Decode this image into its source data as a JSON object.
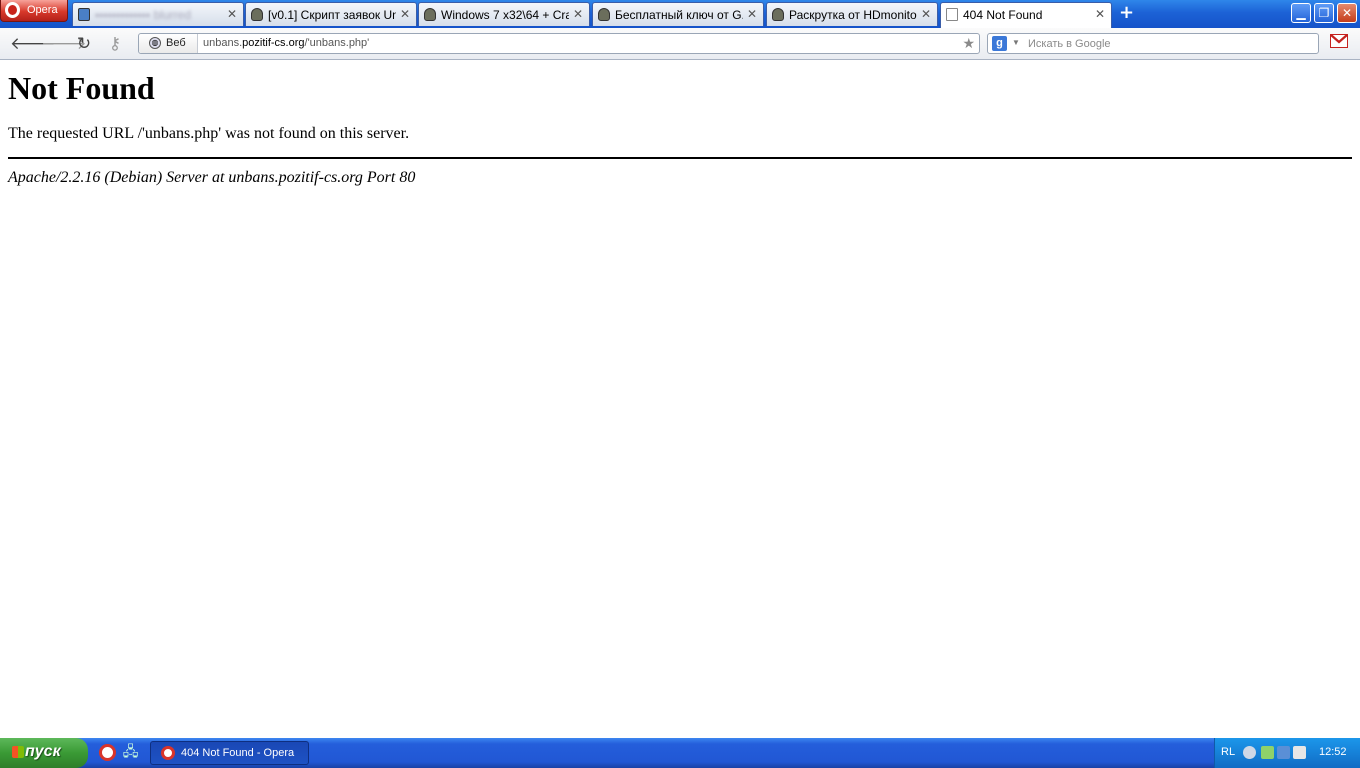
{
  "browser": {
    "menu_label": "Opera",
    "tabs": [
      {
        "label": "▪▪▪▪▪▪▪▪▪▪▪▪▪ blurred",
        "icon": "play-icon",
        "blurred": true
      },
      {
        "label": "[v0.1] Скрипт заявок Un...",
        "icon": "agent-icon"
      },
      {
        "label": "Windows 7 x32\\64 + Cra...",
        "icon": "agent-icon"
      },
      {
        "label": "Бесплатный ключ от G...",
        "icon": "agent-icon"
      },
      {
        "label": "Раскрутка от HDmonito...",
        "icon": "agent-icon"
      },
      {
        "label": "404 Not Found",
        "icon": "page-icon",
        "active": true
      }
    ],
    "close_glyph": "✕",
    "new_tab_glyph": "+",
    "window_controls": {
      "minimize": "▁",
      "maximize": "❐",
      "close": "✕"
    }
  },
  "navbar": {
    "back_glyph": "🡐",
    "forward_glyph": "🡒",
    "reload_glyph": "↻",
    "key_glyph": "⚷",
    "address": {
      "badge": "Веб",
      "url_prefix": "unbans.",
      "url_domain": "pozitif-cs.org",
      "url_path": "/'unbans.php'",
      "bookmark_glyph": "★"
    },
    "search": {
      "engine_glyph": "g",
      "dropdown_glyph": "▼",
      "placeholder": "Искать в Google"
    },
    "gmail_glyph": "M"
  },
  "page": {
    "heading": "Not Found",
    "message": "The requested URL /'unbans.php' was not found on this server.",
    "address": "Apache/2.2.16 (Debian) Server at unbans.pozitif-cs.org Port 80"
  },
  "taskbar": {
    "start_label": "пуск",
    "quick_launch": [
      {
        "name": "opera-icon"
      },
      {
        "name": "network-icon"
      }
    ],
    "net_glyph": "🖧",
    "task": {
      "label": "404 Not Found - Opera"
    },
    "tray": {
      "lang": "RL",
      "clock": "12:52"
    }
  },
  "colors": {
    "title_blue": "#1c62d6",
    "opera_red": "#d8392b",
    "xp_green": "#3a9a35",
    "tray_blue": "#1681d8"
  }
}
